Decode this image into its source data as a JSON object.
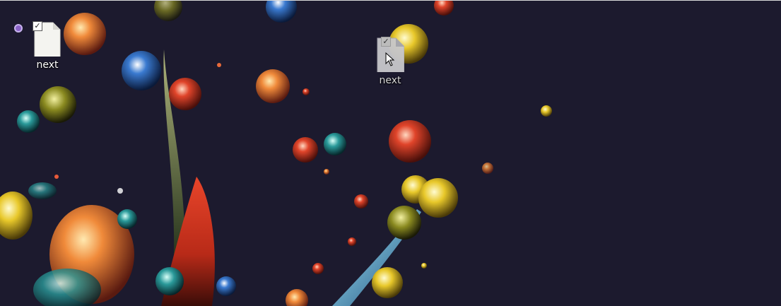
{
  "desktop": {
    "icons": [
      {
        "label": "next",
        "selected": true,
        "state": "normal"
      },
      {
        "label": "next",
        "selected": true,
        "state": "dragging"
      }
    ]
  },
  "colors": {
    "background": "#1c1a2e",
    "label_text": "#ffffff"
  },
  "icon_names": [
    "file-icon",
    "checkbox-icon",
    "cursor-icon"
  ]
}
